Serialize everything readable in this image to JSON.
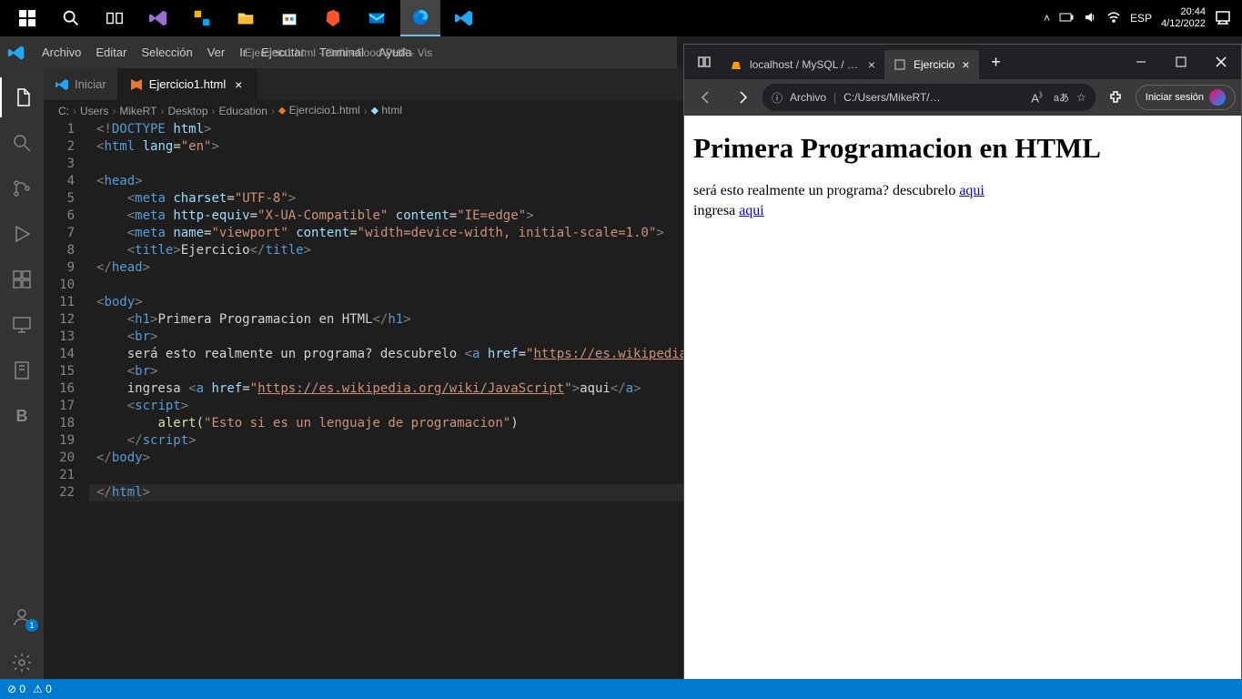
{
  "taskbar": {
    "time": "20:44",
    "date": "4/12/2022",
    "lang": "ESP"
  },
  "vscode": {
    "menu": [
      "Archivo",
      "Editar",
      "Selección",
      "Ver",
      "Ir",
      "Ejecutar",
      "Terminal",
      "Ayuda"
    ],
    "windowTitle": "Ejercicio1.html - OnlineFood-PHP - Vis",
    "tabs": [
      {
        "label": "Iniciar",
        "active": false
      },
      {
        "label": "Ejercicio1.html",
        "active": true
      }
    ],
    "breadcrumb": [
      "C:",
      "Users",
      "MikeRT",
      "Desktop",
      "Education",
      "Ejercicio1.html",
      "html"
    ],
    "code": [
      {
        "n": 1,
        "seg": [
          [
            "t-gray",
            "<!"
          ],
          [
            "t-blue",
            "DOCTYPE"
          ],
          [
            "",
            ""
          ],
          [
            "",
            " "
          ],
          [
            "t-lblue",
            "html"
          ],
          [
            "t-gray",
            ">"
          ]
        ]
      },
      {
        "n": 2,
        "seg": [
          [
            "t-gray",
            "<"
          ],
          [
            "t-blue",
            "html"
          ],
          [
            "",
            " "
          ],
          [
            "t-lblue",
            "lang"
          ],
          [
            "",
            "="
          ],
          [
            "t-str",
            "\"en\""
          ],
          [
            "t-gray",
            ">"
          ]
        ]
      },
      {
        "n": 3,
        "seg": [
          [
            "",
            ""
          ]
        ]
      },
      {
        "n": 4,
        "seg": [
          [
            "t-gray",
            "<"
          ],
          [
            "t-blue",
            "head"
          ],
          [
            "t-gray",
            ">"
          ]
        ]
      },
      {
        "n": 5,
        "seg": [
          [
            "",
            "    "
          ],
          [
            "t-gray",
            "<"
          ],
          [
            "t-blue",
            "meta"
          ],
          [
            "",
            " "
          ],
          [
            "t-lblue",
            "charset"
          ],
          [
            "",
            "="
          ],
          [
            "t-str",
            "\"UTF-8\""
          ],
          [
            "t-gray",
            ">"
          ]
        ]
      },
      {
        "n": 6,
        "seg": [
          [
            "",
            "    "
          ],
          [
            "t-gray",
            "<"
          ],
          [
            "t-blue",
            "meta"
          ],
          [
            "",
            " "
          ],
          [
            "t-lblue",
            "http-equiv"
          ],
          [
            "",
            "="
          ],
          [
            "t-str",
            "\"X-UA-Compatible\""
          ],
          [
            "",
            " "
          ],
          [
            "t-lblue",
            "content"
          ],
          [
            "",
            "="
          ],
          [
            "t-str",
            "\"IE=edge\""
          ],
          [
            "t-gray",
            ">"
          ]
        ]
      },
      {
        "n": 7,
        "seg": [
          [
            "",
            "    "
          ],
          [
            "t-gray",
            "<"
          ],
          [
            "t-blue",
            "meta"
          ],
          [
            "",
            " "
          ],
          [
            "t-lblue",
            "name"
          ],
          [
            "",
            "="
          ],
          [
            "t-str",
            "\"viewport\""
          ],
          [
            "",
            " "
          ],
          [
            "t-lblue",
            "content"
          ],
          [
            "",
            "="
          ],
          [
            "t-str",
            "\"width=device-width, initial-scale=1.0\""
          ],
          [
            "t-gray",
            ">"
          ]
        ]
      },
      {
        "n": 8,
        "seg": [
          [
            "",
            "    "
          ],
          [
            "t-gray",
            "<"
          ],
          [
            "t-blue",
            "title"
          ],
          [
            "t-gray",
            ">"
          ],
          [
            "",
            "Ejercicio"
          ],
          [
            "t-gray",
            "</"
          ],
          [
            "t-blue",
            "title"
          ],
          [
            "t-gray",
            ">"
          ]
        ]
      },
      {
        "n": 9,
        "seg": [
          [
            "t-gray",
            "</"
          ],
          [
            "t-blue",
            "head"
          ],
          [
            "t-gray",
            ">"
          ]
        ]
      },
      {
        "n": 10,
        "seg": [
          [
            "",
            ""
          ]
        ]
      },
      {
        "n": 11,
        "seg": [
          [
            "t-gray",
            "<"
          ],
          [
            "t-blue",
            "body"
          ],
          [
            "t-gray",
            ">"
          ]
        ]
      },
      {
        "n": 12,
        "seg": [
          [
            "",
            "    "
          ],
          [
            "t-gray",
            "<"
          ],
          [
            "t-blue",
            "h1"
          ],
          [
            "t-gray",
            ">"
          ],
          [
            "",
            "Primera Programacion en HTML"
          ],
          [
            "t-gray",
            "</"
          ],
          [
            "t-blue",
            "h1"
          ],
          [
            "t-gray",
            ">"
          ]
        ]
      },
      {
        "n": 13,
        "seg": [
          [
            "",
            "    "
          ],
          [
            "t-gray",
            "<"
          ],
          [
            "t-blue",
            "br"
          ],
          [
            "t-gray",
            ">"
          ]
        ]
      },
      {
        "n": 14,
        "seg": [
          [
            "",
            "    será esto realmente un programa? descubrelo "
          ],
          [
            "t-gray",
            "<"
          ],
          [
            "t-blue",
            "a"
          ],
          [
            "",
            " "
          ],
          [
            "t-lblue",
            "href"
          ],
          [
            "",
            "="
          ],
          [
            "t-str",
            "\""
          ],
          [
            "t-link",
            "https://es.wikipedia.org/"
          ]
        ]
      },
      {
        "n": 15,
        "seg": [
          [
            "",
            "    "
          ],
          [
            "t-gray",
            "<"
          ],
          [
            "t-blue",
            "br"
          ],
          [
            "t-gray",
            ">"
          ]
        ]
      },
      {
        "n": 16,
        "seg": [
          [
            "",
            "    ingresa "
          ],
          [
            "t-gray",
            "<"
          ],
          [
            "t-blue",
            "a"
          ],
          [
            "",
            " "
          ],
          [
            "t-lblue",
            "href"
          ],
          [
            "",
            "="
          ],
          [
            "t-str",
            "\""
          ],
          [
            "t-link",
            "https://es.wikipedia.org/wiki/JavaScript"
          ],
          [
            "t-str",
            "\""
          ],
          [
            "t-gray",
            ">"
          ],
          [
            "",
            "aqui"
          ],
          [
            "t-gray",
            "</"
          ],
          [
            "t-blue",
            "a"
          ],
          [
            "t-gray",
            ">"
          ]
        ]
      },
      {
        "n": 17,
        "seg": [
          [
            "",
            "    "
          ],
          [
            "t-gray",
            "<"
          ],
          [
            "t-blue",
            "script"
          ],
          [
            "t-gray",
            ">"
          ]
        ]
      },
      {
        "n": 18,
        "seg": [
          [
            "",
            "        "
          ],
          [
            "t-fn",
            "alert"
          ],
          [
            "",
            "("
          ],
          [
            "t-str",
            "\"Esto si es un lenguaje de programacion\""
          ],
          [
            "",
            ")"
          ]
        ]
      },
      {
        "n": 19,
        "seg": [
          [
            "",
            "    "
          ],
          [
            "t-gray",
            "</"
          ],
          [
            "t-blue",
            "script"
          ],
          [
            "t-gray",
            ">"
          ]
        ]
      },
      {
        "n": 20,
        "seg": [
          [
            "t-gray",
            "</"
          ],
          [
            "t-blue",
            "body"
          ],
          [
            "t-gray",
            ">"
          ]
        ]
      },
      {
        "n": 21,
        "seg": [
          [
            "",
            ""
          ]
        ]
      },
      {
        "n": 22,
        "hl": true,
        "seg": [
          [
            "t-gray",
            "</"
          ],
          [
            "t-blue",
            "html"
          ],
          [
            "t-gray",
            ">"
          ]
        ]
      }
    ],
    "status": {
      "errors": "0",
      "warnings": "0"
    }
  },
  "edge": {
    "tabs": [
      {
        "label": "localhost / MySQL / onlinef…",
        "active": false
      },
      {
        "label": "Ejercicio",
        "active": true
      }
    ],
    "addrLabel": "Archivo",
    "addrPath": "C:/Users/MikeRT/…",
    "signIn": "Iniciar sesión",
    "page": {
      "h1": "Primera Programacion en HTML",
      "text1": "será esto realmente un programa? descubrelo ",
      "link1": "aqui",
      "text2": "ingresa ",
      "link2": "aqui"
    }
  }
}
